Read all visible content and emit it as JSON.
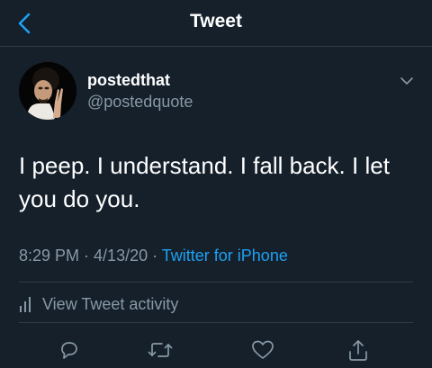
{
  "header": {
    "title": "Tweet",
    "back_icon": "chevron-left-icon",
    "accent_color": "#1da1f2"
  },
  "author": {
    "display_name": "postedthat",
    "handle": "@postedquote",
    "more_icon": "chevron-down-icon"
  },
  "tweet": {
    "text": "I peep. I understand. I fall back. I let you do you.",
    "time": "8:29 PM",
    "sep1": " · ",
    "date": "4/13/20",
    "sep2": " · ",
    "source": "Twitter for iPhone"
  },
  "activity": {
    "label": "View Tweet activity",
    "icon": "bar-chart-icon"
  },
  "actions": [
    {
      "icon": "reply-icon"
    },
    {
      "icon": "retweet-icon"
    },
    {
      "icon": "like-icon"
    },
    {
      "icon": "share-icon"
    }
  ],
  "colors": {
    "background": "#15202b",
    "secondary_text": "#8899a6",
    "divider": "#2f3b47"
  }
}
